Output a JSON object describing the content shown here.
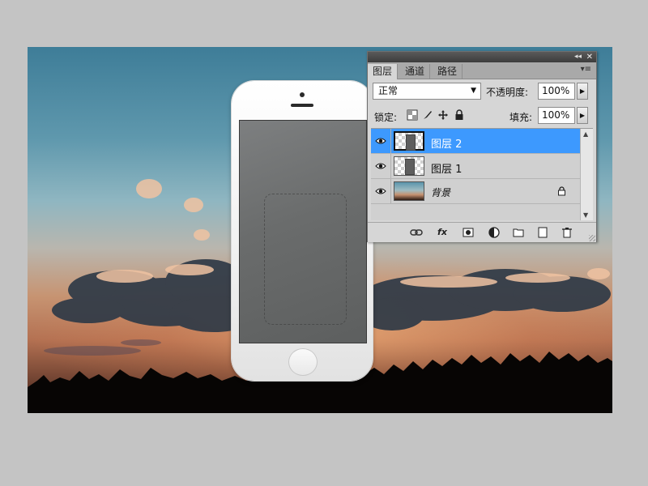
{
  "layers_panel": {
    "tabs": [
      {
        "label": "图层",
        "active": true
      },
      {
        "label": "通道",
        "active": false
      },
      {
        "label": "路径",
        "active": false
      }
    ],
    "collapse_glyph": "◂◂",
    "close_glyph": "✕",
    "menu_glyph": "▾≡",
    "blend_mode": "正常",
    "opacity_label": "不透明度:",
    "opacity_value": "100%",
    "lock_label": "锁定:",
    "fill_label": "填充:",
    "fill_value": "100%",
    "lock_icons": [
      "lock-transparent-icon",
      "lock-image-icon",
      "lock-position-icon",
      "lock-all-icon"
    ],
    "layers": [
      {
        "name": "图层 2",
        "selected": true,
        "visible": true,
        "thumbnail": "phone-on-transparent"
      },
      {
        "name": "图层 1",
        "selected": false,
        "visible": true,
        "thumbnail": "phone-on-transparent"
      },
      {
        "name": "背景",
        "selected": false,
        "visible": true,
        "locked": true,
        "thumbnail": "sunset-photo"
      }
    ],
    "footer_buttons": [
      "link-layers-icon",
      "fx-icon",
      "add-mask-icon",
      "adjustment-layer-icon",
      "new-group-icon",
      "new-layer-icon",
      "trash-icon"
    ],
    "footer_fx_label": "fx",
    "selection_color": "#3d99fe"
  },
  "canvas": {
    "content": "sunset-sky-with-phone-mockup"
  }
}
